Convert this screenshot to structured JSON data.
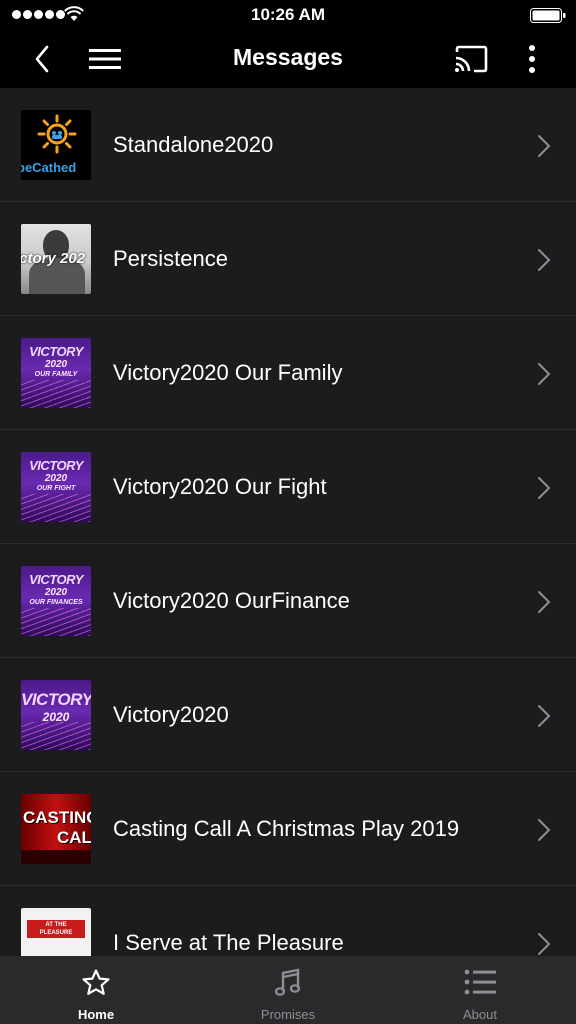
{
  "status_bar": {
    "time": "10:26 AM",
    "signal_icon": "signal-dots-icon",
    "wifi_icon": "wifi-icon",
    "battery_icon": "battery-full-icon"
  },
  "nav": {
    "title": "Messages",
    "back_icon": "chevron-left-icon",
    "menu_icon": "hamburger-menu-icon",
    "cast_icon": "cast-icon",
    "more_icon": "more-vertical-icon"
  },
  "messages": [
    {
      "title": "Standalone2020",
      "thumb_text": "peCathed"
    },
    {
      "title": "Persistence",
      "thumb_text": "ictory 202"
    },
    {
      "title": "Victory2020 Our Family",
      "thumb_lines": [
        "VICTORY",
        "2020",
        "OUR FAMILY"
      ]
    },
    {
      "title": "Victory2020 Our Fight",
      "thumb_lines": [
        "VICTORY",
        "2020",
        "OUR FIGHT"
      ]
    },
    {
      "title": "Victory2020 OurFinance",
      "thumb_lines": [
        "VICTORY",
        "2020",
        "OUR FINANCES"
      ]
    },
    {
      "title": "Victory2020",
      "thumb_lines": [
        "VICTORY",
        "2020"
      ]
    },
    {
      "title": "Casting Call A Christmas Play 2019",
      "thumb_lines": [
        "CASTING",
        "CALL"
      ]
    },
    {
      "title": "I Serve at The Pleasure",
      "thumb_lines": [
        "AT THE",
        "PLEASURE"
      ]
    }
  ],
  "tabs": [
    {
      "label": "Home",
      "icon": "star-icon",
      "active": true
    },
    {
      "label": "Promises",
      "icon": "music-note-icon",
      "active": false
    },
    {
      "label": "About",
      "icon": "list-icon",
      "active": false
    }
  ],
  "colors": {
    "background": "#1c1c1e",
    "bar": "#000000",
    "tab_bar": "#2a2a2c",
    "separator": "#2e2e31",
    "inactive_tab": "#8e8e93",
    "chevron": "#8e8e93"
  }
}
